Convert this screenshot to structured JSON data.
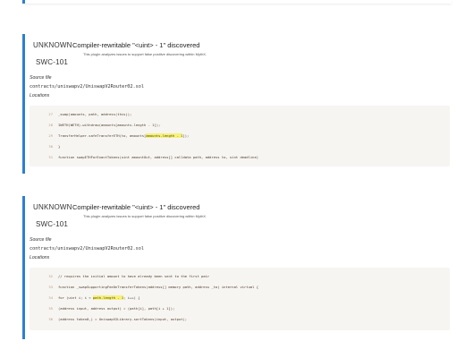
{
  "findings": [
    {
      "severity": "UNKNOWN",
      "swc": "SWC-101",
      "title": "Compiler-rewritable \"<uint> - 1\" discovered",
      "description": "This plugin analyzes issues to support false positive discovering within MythX.",
      "source_label": "Source file",
      "source_file": "contracts/uniswapv2/UniswapV2Router02.sol",
      "locations_label": "Locations",
      "code_lines": [
        {
          "num": "27",
          "pre": "_swap(amounts, path, address(this));",
          "hl": "",
          "post": ""
        },
        {
          "num": "28",
          "pre": "IWETH(WETH).withdraw(amounts[amounts.length - 1]);",
          "hl": "",
          "post": ""
        },
        {
          "num": "29",
          "pre": "TransferHelper.safeTransferETH(to, amounts[",
          "hl": "amounts.length - 1",
          "post": "]);"
        },
        {
          "num": "30",
          "pre": "}",
          "hl": "",
          "post": ""
        },
        {
          "num": "31",
          "pre": "function swapETHForExactTokens(uint amountOut, address[] calldata path, address to, uint deadline)",
          "hl": "",
          "post": ""
        }
      ]
    },
    {
      "severity": "UNKNOWN",
      "swc": "SWC-101",
      "title": "Compiler-rewritable \"<uint> - 1\" discovered",
      "description": "This plugin analyzes issues to support false positive discovering within MythX.",
      "source_label": "Source file",
      "source_file": "contracts/uniswapv2/UniswapV2Router02.sol",
      "locations_label": "Locations",
      "code_lines": [
        {
          "num": "32",
          "pre": "// requires the initial amount to have already been sent to the first pair",
          "hl": "",
          "post": ""
        },
        {
          "num": "33",
          "pre": "function _swapSupportingFeeOnTransferTokens(address[] memory path, address _to) internal virtual {",
          "hl": "",
          "post": ""
        },
        {
          "num": "34",
          "pre": "for (uint i; i < ",
          "hl": "path.length - 1",
          "post": "; i++) {"
        },
        {
          "num": "35",
          "pre": "(address input, address output) = (path[i], path[i + 1]);",
          "hl": "",
          "post": ""
        },
        {
          "num": "36",
          "pre": "(address token0,) = UniswapV2Library.sortTokens(input, output);",
          "hl": "",
          "post": ""
        }
      ]
    }
  ]
}
